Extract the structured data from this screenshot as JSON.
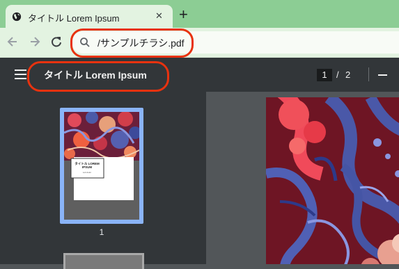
{
  "browser": {
    "tab": {
      "title": "タイトル Lorem Ipsum",
      "icon": "globe-icon",
      "close": "✕"
    },
    "new_tab_icon": "+",
    "address_bar": {
      "url": "/サンプルチラシ.pdf",
      "icon": "search-icon"
    }
  },
  "pdf_viewer": {
    "document_title": "タイトル Lorem Ipsum",
    "current_page": "1",
    "page_separator": "/",
    "total_pages": "2",
    "thumbnails": [
      {
        "label": "1"
      }
    ],
    "thumbnail_card": {
      "title": "タイトル LOREM IPSUM",
      "text": "Loti dolor"
    }
  },
  "colors": {
    "tabstrip": "#8ccd94",
    "toolbar": "#e3f3e1",
    "pdf_toolbar": "#323639",
    "viewer_bg": "#525659",
    "annotation": "#e8320f",
    "selected_thumbnail": "#8ab4f8"
  }
}
